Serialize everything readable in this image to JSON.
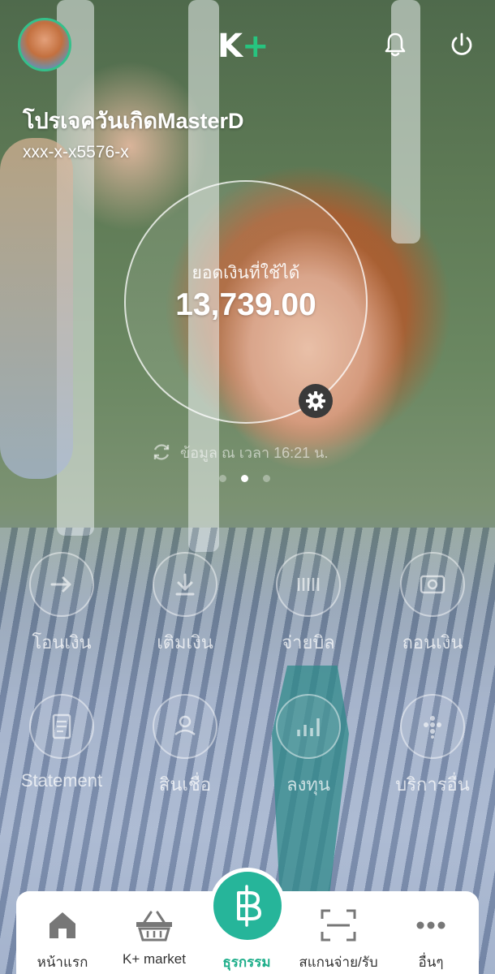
{
  "header": {
    "logo_k": "K",
    "logo_plus": "+",
    "account_name": "โปรเจควันเกิดMasterD",
    "account_number": "xxx-x-x5576-x"
  },
  "balance": {
    "label": "ยอดเงินที่ใช้ได้",
    "amount": "13,739.00",
    "updated_text": "ข้อมูล ณ เวลา 16:21 น."
  },
  "pager": {
    "count": 3,
    "active_index": 1
  },
  "menu": [
    {
      "label": "โอนเงิน",
      "icon": "transfer-icon"
    },
    {
      "label": "เติมเงิน",
      "icon": "topup-icon"
    },
    {
      "label": "จ่ายบิล",
      "icon": "pay-bill-icon"
    },
    {
      "label": "ถอนเงิน",
      "icon": "withdraw-icon"
    },
    {
      "label": "Statement",
      "icon": "statement-icon"
    },
    {
      "label": "สินเชื่อ",
      "icon": "loan-icon"
    },
    {
      "label": "ลงทุน",
      "icon": "invest-icon"
    },
    {
      "label": "บริการอื่น",
      "icon": "other-services-icon"
    }
  ],
  "bottom_nav": [
    {
      "label": "หน้าแรก",
      "icon": "home-icon"
    },
    {
      "label": "K+ market",
      "icon": "basket-icon"
    },
    {
      "label": "ธุรกรรม",
      "icon": "baht-icon",
      "active": true
    },
    {
      "label": "สแกนจ่าย/รับ",
      "icon": "scan-icon"
    },
    {
      "label": "อื่นๆ",
      "icon": "more-icon"
    }
  ],
  "colors": {
    "brand_green": "#27c47f",
    "active_tab": "#1eae8a",
    "center_button": "#26b59a"
  }
}
